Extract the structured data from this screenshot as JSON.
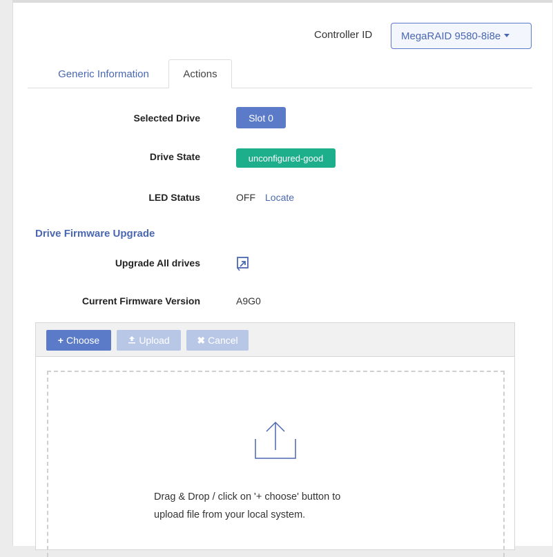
{
  "controller": {
    "label": "Controller ID",
    "selected": "MegaRAID 9580-8i8e"
  },
  "tabs": [
    {
      "label": "Generic Information",
      "active": false
    },
    {
      "label": "Actions",
      "active": true
    }
  ],
  "fields": {
    "selected_drive": {
      "label": "Selected Drive",
      "value": "Slot 0"
    },
    "drive_state": {
      "label": "Drive State",
      "value": "unconfigured-good"
    },
    "led_status": {
      "label": "LED Status",
      "value": "OFF",
      "action": "Locate"
    }
  },
  "firmware": {
    "section_title": "Drive Firmware Upgrade",
    "upgrade_all_label": "Upgrade All drives",
    "current_version_label": "Current Firmware Version",
    "current_version": "A9G0"
  },
  "uploader": {
    "choose_label": "Choose",
    "upload_label": "Upload",
    "cancel_label": "Cancel",
    "drop_text_line1": "Drag & Drop / click on '+ choose' button to",
    "drop_text_line2": "upload file from your local system."
  },
  "colors": {
    "accent": "#5b7bc8",
    "link": "#4a67b1",
    "success": "#1dae8c",
    "disabled": "#b9c7e6"
  }
}
